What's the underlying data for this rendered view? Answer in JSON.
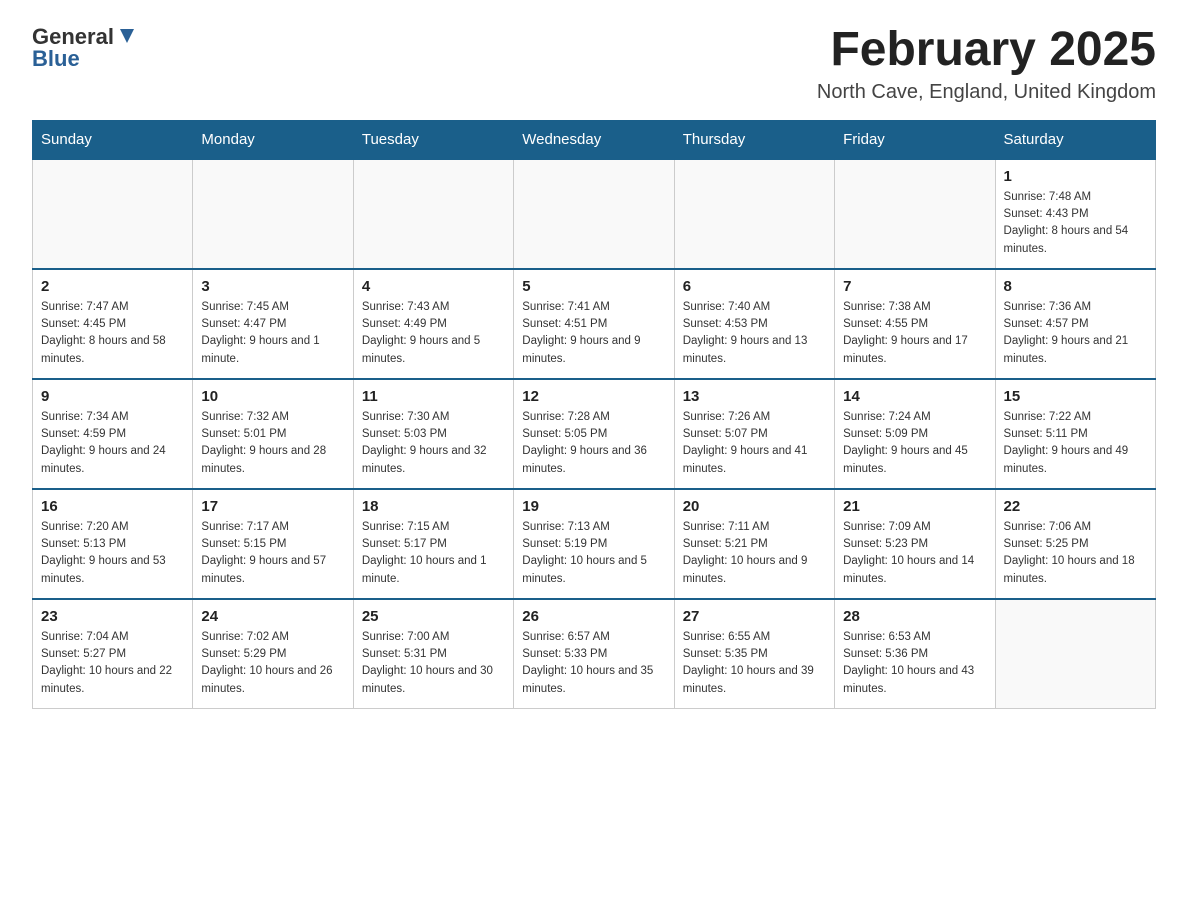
{
  "header": {
    "logo_general": "General",
    "logo_blue": "Blue",
    "title": "February 2025",
    "location": "North Cave, England, United Kingdom"
  },
  "weekdays": [
    "Sunday",
    "Monday",
    "Tuesday",
    "Wednesday",
    "Thursday",
    "Friday",
    "Saturday"
  ],
  "weeks": [
    [
      {
        "day": "",
        "sunrise": "",
        "sunset": "",
        "daylight": ""
      },
      {
        "day": "",
        "sunrise": "",
        "sunset": "",
        "daylight": ""
      },
      {
        "day": "",
        "sunrise": "",
        "sunset": "",
        "daylight": ""
      },
      {
        "day": "",
        "sunrise": "",
        "sunset": "",
        "daylight": ""
      },
      {
        "day": "",
        "sunrise": "",
        "sunset": "",
        "daylight": ""
      },
      {
        "day": "",
        "sunrise": "",
        "sunset": "",
        "daylight": ""
      },
      {
        "day": "1",
        "sunrise": "Sunrise: 7:48 AM",
        "sunset": "Sunset: 4:43 PM",
        "daylight": "Daylight: 8 hours and 54 minutes."
      }
    ],
    [
      {
        "day": "2",
        "sunrise": "Sunrise: 7:47 AM",
        "sunset": "Sunset: 4:45 PM",
        "daylight": "Daylight: 8 hours and 58 minutes."
      },
      {
        "day": "3",
        "sunrise": "Sunrise: 7:45 AM",
        "sunset": "Sunset: 4:47 PM",
        "daylight": "Daylight: 9 hours and 1 minute."
      },
      {
        "day": "4",
        "sunrise": "Sunrise: 7:43 AM",
        "sunset": "Sunset: 4:49 PM",
        "daylight": "Daylight: 9 hours and 5 minutes."
      },
      {
        "day": "5",
        "sunrise": "Sunrise: 7:41 AM",
        "sunset": "Sunset: 4:51 PM",
        "daylight": "Daylight: 9 hours and 9 minutes."
      },
      {
        "day": "6",
        "sunrise": "Sunrise: 7:40 AM",
        "sunset": "Sunset: 4:53 PM",
        "daylight": "Daylight: 9 hours and 13 minutes."
      },
      {
        "day": "7",
        "sunrise": "Sunrise: 7:38 AM",
        "sunset": "Sunset: 4:55 PM",
        "daylight": "Daylight: 9 hours and 17 minutes."
      },
      {
        "day": "8",
        "sunrise": "Sunrise: 7:36 AM",
        "sunset": "Sunset: 4:57 PM",
        "daylight": "Daylight: 9 hours and 21 minutes."
      }
    ],
    [
      {
        "day": "9",
        "sunrise": "Sunrise: 7:34 AM",
        "sunset": "Sunset: 4:59 PM",
        "daylight": "Daylight: 9 hours and 24 minutes."
      },
      {
        "day": "10",
        "sunrise": "Sunrise: 7:32 AM",
        "sunset": "Sunset: 5:01 PM",
        "daylight": "Daylight: 9 hours and 28 minutes."
      },
      {
        "day": "11",
        "sunrise": "Sunrise: 7:30 AM",
        "sunset": "Sunset: 5:03 PM",
        "daylight": "Daylight: 9 hours and 32 minutes."
      },
      {
        "day": "12",
        "sunrise": "Sunrise: 7:28 AM",
        "sunset": "Sunset: 5:05 PM",
        "daylight": "Daylight: 9 hours and 36 minutes."
      },
      {
        "day": "13",
        "sunrise": "Sunrise: 7:26 AM",
        "sunset": "Sunset: 5:07 PM",
        "daylight": "Daylight: 9 hours and 41 minutes."
      },
      {
        "day": "14",
        "sunrise": "Sunrise: 7:24 AM",
        "sunset": "Sunset: 5:09 PM",
        "daylight": "Daylight: 9 hours and 45 minutes."
      },
      {
        "day": "15",
        "sunrise": "Sunrise: 7:22 AM",
        "sunset": "Sunset: 5:11 PM",
        "daylight": "Daylight: 9 hours and 49 minutes."
      }
    ],
    [
      {
        "day": "16",
        "sunrise": "Sunrise: 7:20 AM",
        "sunset": "Sunset: 5:13 PM",
        "daylight": "Daylight: 9 hours and 53 minutes."
      },
      {
        "day": "17",
        "sunrise": "Sunrise: 7:17 AM",
        "sunset": "Sunset: 5:15 PM",
        "daylight": "Daylight: 9 hours and 57 minutes."
      },
      {
        "day": "18",
        "sunrise": "Sunrise: 7:15 AM",
        "sunset": "Sunset: 5:17 PM",
        "daylight": "Daylight: 10 hours and 1 minute."
      },
      {
        "day": "19",
        "sunrise": "Sunrise: 7:13 AM",
        "sunset": "Sunset: 5:19 PM",
        "daylight": "Daylight: 10 hours and 5 minutes."
      },
      {
        "day": "20",
        "sunrise": "Sunrise: 7:11 AM",
        "sunset": "Sunset: 5:21 PM",
        "daylight": "Daylight: 10 hours and 9 minutes."
      },
      {
        "day": "21",
        "sunrise": "Sunrise: 7:09 AM",
        "sunset": "Sunset: 5:23 PM",
        "daylight": "Daylight: 10 hours and 14 minutes."
      },
      {
        "day": "22",
        "sunrise": "Sunrise: 7:06 AM",
        "sunset": "Sunset: 5:25 PM",
        "daylight": "Daylight: 10 hours and 18 minutes."
      }
    ],
    [
      {
        "day": "23",
        "sunrise": "Sunrise: 7:04 AM",
        "sunset": "Sunset: 5:27 PM",
        "daylight": "Daylight: 10 hours and 22 minutes."
      },
      {
        "day": "24",
        "sunrise": "Sunrise: 7:02 AM",
        "sunset": "Sunset: 5:29 PM",
        "daylight": "Daylight: 10 hours and 26 minutes."
      },
      {
        "day": "25",
        "sunrise": "Sunrise: 7:00 AM",
        "sunset": "Sunset: 5:31 PM",
        "daylight": "Daylight: 10 hours and 30 minutes."
      },
      {
        "day": "26",
        "sunrise": "Sunrise: 6:57 AM",
        "sunset": "Sunset: 5:33 PM",
        "daylight": "Daylight: 10 hours and 35 minutes."
      },
      {
        "day": "27",
        "sunrise": "Sunrise: 6:55 AM",
        "sunset": "Sunset: 5:35 PM",
        "daylight": "Daylight: 10 hours and 39 minutes."
      },
      {
        "day": "28",
        "sunrise": "Sunrise: 6:53 AM",
        "sunset": "Sunset: 5:36 PM",
        "daylight": "Daylight: 10 hours and 43 minutes."
      },
      {
        "day": "",
        "sunrise": "",
        "sunset": "",
        "daylight": ""
      }
    ]
  ]
}
